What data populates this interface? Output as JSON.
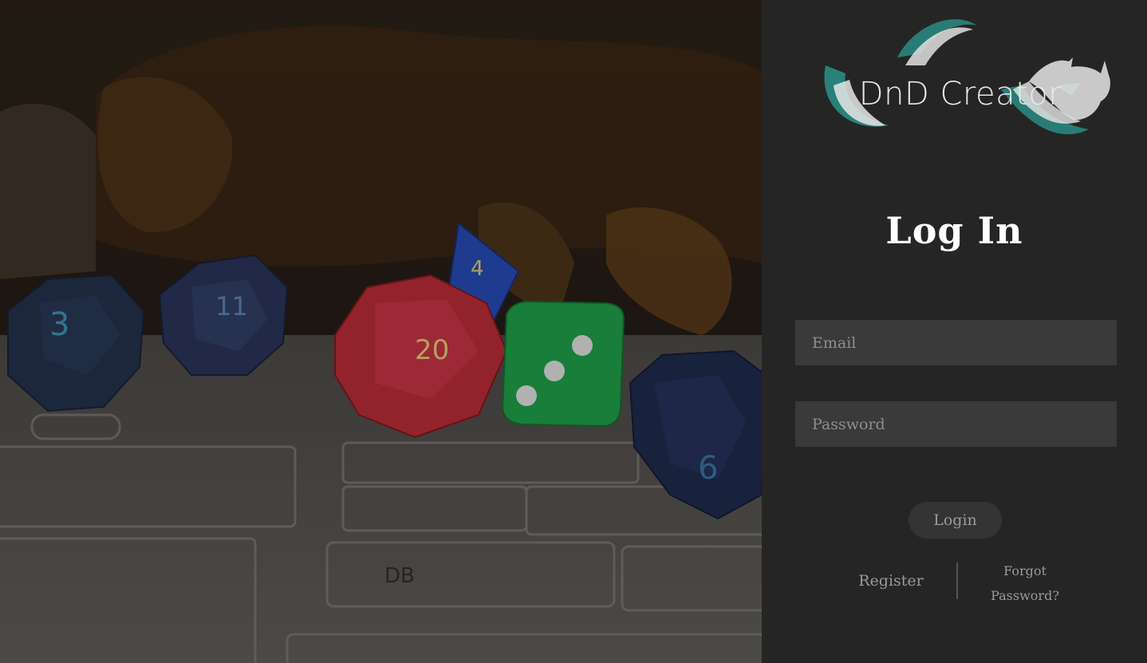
{
  "brand": {
    "name": "DnD Creator",
    "accent_color": "#2a8c84"
  },
  "login": {
    "heading": "Log In",
    "email_placeholder": "Email",
    "email_value": "",
    "password_placeholder": "Password",
    "password_value": "",
    "login_label": "Login",
    "register_label": "Register",
    "forgot_label": "Forgot Password?"
  },
  "hero": {
    "subject": "polyhedral dice on a character sheet",
    "dice": [
      {
        "kind": "d12",
        "color": "#24304a",
        "face": "3"
      },
      {
        "kind": "d12",
        "color": "#2a3356",
        "face": "11"
      },
      {
        "kind": "d20",
        "color": "#b32a35",
        "face": "20"
      },
      {
        "kind": "d4",
        "color": "#2548b0",
        "face": "4"
      },
      {
        "kind": "d6",
        "color": "#1f9a46",
        "face": "3"
      },
      {
        "kind": "d10",
        "color": "#1f2a4a",
        "face": "6"
      }
    ],
    "sheet_labels": [
      "DB"
    ]
  }
}
